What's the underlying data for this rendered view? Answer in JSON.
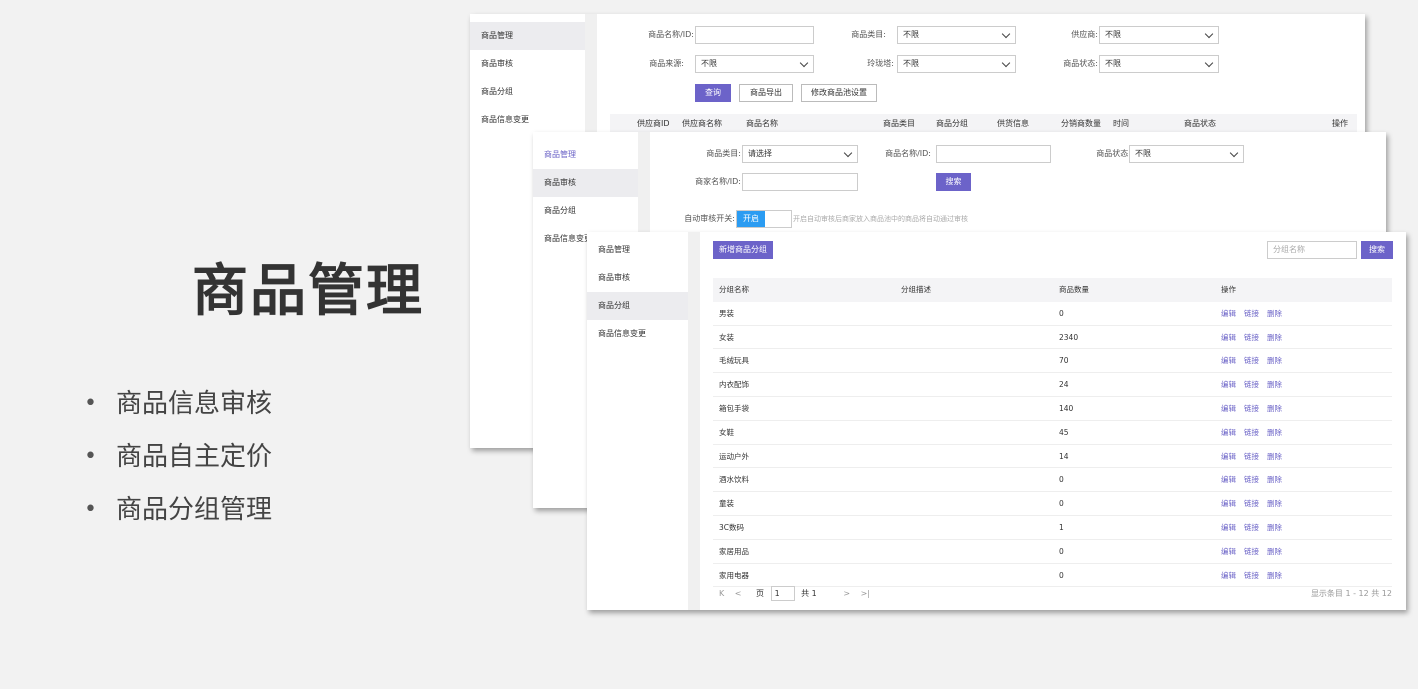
{
  "slide": {
    "title": "商品管理",
    "bullets": [
      "商品信息审核",
      "商品自主定价",
      "商品分组管理"
    ]
  },
  "sidebar": {
    "items": [
      "商品管理",
      "商品审核",
      "商品分组",
      "商品信息变更"
    ]
  },
  "win1": {
    "filters": {
      "name_label": "商品名称/ID:",
      "category_label": "商品类目:",
      "category_value": "不限",
      "supplier_label": "供应商:",
      "supplier_value": "不限",
      "source_label": "商品来源:",
      "source_value": "不限",
      "channel_label": "玲珑塔:",
      "channel_value": "不限",
      "status_label": "商品状态:",
      "status_value": "不限"
    },
    "buttons": {
      "query": "查询",
      "export": "商品导出",
      "pool": "修改商品池设置"
    },
    "columns": [
      "供应商ID",
      "供应商名称",
      "商品名称",
      "商品类目",
      "商品分组",
      "供货信息",
      "分销商数量",
      "时间",
      "商品状态",
      "操作"
    ]
  },
  "win2": {
    "category_label": "商品类目:",
    "category_value": "请选择",
    "name_label": "商品名称/ID:",
    "status_label": "商品状态:",
    "status_value": "不限",
    "merchant_label": "商家名称/ID:",
    "search": "搜索",
    "auto_label": "自动审核开关:",
    "auto_on": "开启",
    "auto_hint": "开启自动审核后商家放入商品池中的商品将自动通过审核"
  },
  "win3": {
    "add_button": "新增商品分组",
    "search_placeholder": "分组名称",
    "search_button": "搜索",
    "columns": [
      "分组名称",
      "分组描述",
      "商品数量",
      "操作"
    ],
    "actions": [
      "编辑",
      "链接",
      "删除"
    ],
    "rows": [
      {
        "name": "男装",
        "desc": "",
        "count": "0"
      },
      {
        "name": "女装",
        "desc": "",
        "count": "2340"
      },
      {
        "name": "毛绒玩具",
        "desc": "",
        "count": "70"
      },
      {
        "name": "内衣配饰",
        "desc": "",
        "count": "24"
      },
      {
        "name": "箱包手袋",
        "desc": "",
        "count": "140"
      },
      {
        "name": "女鞋",
        "desc": "",
        "count": "45"
      },
      {
        "name": "运动户外",
        "desc": "",
        "count": "14"
      },
      {
        "name": "酒水饮料",
        "desc": "",
        "count": "0"
      },
      {
        "name": "童装",
        "desc": "",
        "count": "0"
      },
      {
        "name": "3C数码",
        "desc": "",
        "count": "1"
      },
      {
        "name": "家居用品",
        "desc": "",
        "count": "0"
      },
      {
        "name": "家用电器",
        "desc": "",
        "count": "0"
      }
    ],
    "pager": {
      "first": "K",
      "prev": "<",
      "page_label": "页",
      "page_value": "1",
      "total": "共 1",
      "next": ">",
      "last": ">|",
      "summary": "显示条目 1 - 12 共 12"
    }
  }
}
